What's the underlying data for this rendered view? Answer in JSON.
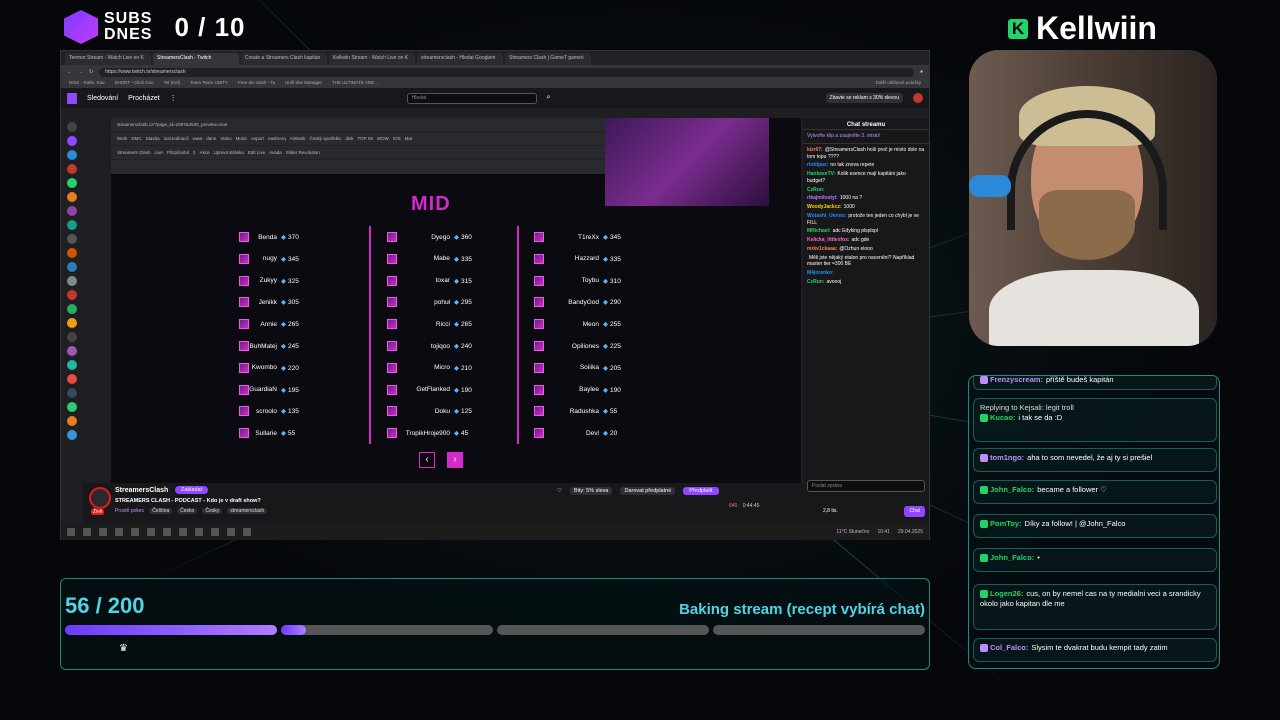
{
  "overlay": {
    "subs_label_1": "SUBS",
    "subs_label_2": "DNES",
    "subs_count": "0 / 10",
    "brand_name": "Kellwiin",
    "goal_count": "56 / 200",
    "goal_title": "Baking stream (recept vybírá chat)",
    "goal_progress": 0.28,
    "colors": {
      "accent_cyan": "#4fd6e6",
      "accent_purple": "#9146ff",
      "accent_magenta": "#d42ac8",
      "brand_green": "#22d36a"
    }
  },
  "browser": {
    "tabs": [
      "Teemor Stream - Watch Live on K",
      "StreamersClash - Twitch",
      "Create a Streamers Clash kapitán",
      "Kellwiin Stream - Watch Live on K",
      "streamersclash - Hledat Googlem",
      "Streamers Clash | GameT gameri"
    ],
    "url": "https://www.twitch.tv/streamersclash",
    "bookmarks": [
      "DISK - Rafie, Kau",
      "SHORT - Click Goo",
      "Tel (Kel)",
      "Team Team UNITY",
      "Free elo clash - Ta",
      "Unifi Site Manager",
      "THE ULTIMATE ARE..."
    ],
    "bookmarks_right": "Další oblíbené položky",
    "twitch_nav": {
      "following": "Sledování",
      "browse": "Procházet",
      "search_placeholder": "Hledat",
      "ad_button": "Zbavte se reklam s 30% slevou"
    },
    "inner_url": "streamersclash.cz/?page_id=2397&3530_preview=true",
    "inner_bookmarks": [
      "Work",
      "DMC",
      "Stavba",
      "Iza/Jedinacil",
      "www",
      "dane",
      "Video",
      "Music",
      "export",
      "nadmorq",
      "AirBank",
      "Český spotřebic",
      "disk",
      "TOP 09",
      "WOW",
      "IOS",
      "Mat"
    ],
    "inner_toolbar": [
      "Streamers Clash",
      "Live",
      "Přizpůsobit",
      "0",
      "Akce",
      "Upravit stránku",
      "Edit Live",
      "Avada",
      "Slider Revolution"
    ],
    "tier_title": "MID",
    "columns": [
      [
        {
          "name": "Benda",
          "points": "370"
        },
        {
          "name": "nugy",
          "points": "345"
        },
        {
          "name": "Zukyy",
          "points": "325"
        },
        {
          "name": "Jenikk",
          "points": "305"
        },
        {
          "name": "Annie",
          "points": "265"
        },
        {
          "name": "BuhMatej",
          "points": "245"
        },
        {
          "name": "Kwombo",
          "points": "220"
        },
        {
          "name": "GuardiaN",
          "points": "195"
        },
        {
          "name": "scroolo",
          "points": "135"
        },
        {
          "name": "Sullarie",
          "points": "55"
        }
      ],
      [
        {
          "name": "Dyego",
          "points": "360"
        },
        {
          "name": "Mabe",
          "points": "335"
        },
        {
          "name": "toxar",
          "points": "315"
        },
        {
          "name": "pohuł",
          "points": "295"
        },
        {
          "name": "Ricci",
          "points": "265"
        },
        {
          "name": "tojiqoo",
          "points": "240"
        },
        {
          "name": "Micro",
          "points": "210"
        },
        {
          "name": "GetFlanked",
          "points": "190"
        },
        {
          "name": "Doku",
          "points": "125"
        },
        {
          "name": "TropikHroje900",
          "points": "45"
        }
      ],
      [
        {
          "name": "T1reXx",
          "points": "345"
        },
        {
          "name": "Hazzard",
          "points": "335"
        },
        {
          "name": "Toybu",
          "points": "310"
        },
        {
          "name": "BandyGod",
          "points": "290"
        },
        {
          "name": "Meon",
          "points": "255"
        },
        {
          "name": "Opiliones",
          "points": "225"
        },
        {
          "name": "Soiiika",
          "points": "205"
        },
        {
          "name": "Baylee",
          "points": "190"
        },
        {
          "name": "Radushka",
          "points": "55"
        },
        {
          "name": "Devl",
          "points": "20"
        }
      ]
    ],
    "channel": {
      "name": "StreamersClash",
      "follow": "Zakladat",
      "title": "STREAMERS CLASH - PODCAST - Kdo je v draft show?",
      "tags_label": "Prostě pokec",
      "tags": [
        "Čeština",
        "Česko",
        "Česky",
        "streamersclash"
      ],
      "live": "Živě",
      "bits": "Bity: 5% sleva",
      "gift": "Darovat předplatné",
      "subscribe": "Předplatit",
      "viewers": "840",
      "uptime": "0:44:45"
    },
    "chat": {
      "header": "Chat streamu",
      "pin": "Vytvořte klip a zaujměte 3. místo!",
      "messages": [
        {
          "user": "kizr07:",
          "text": "@StreamersClash hoši proč je místo dole na tom topu ????",
          "color": "#ff7f50"
        },
        {
          "user": "rlotdpax:",
          "text": "no tak znova repete",
          "color": "#1e90ff"
        },
        {
          "user": "HankeeeTV:",
          "text": "Kolik esence mají kapitáni jako budget?",
          "color": "#22d36a"
        },
        {
          "user": "CzRun:",
          "text": "",
          "color": "#22d36a"
        },
        {
          "user": "rikajmilostyi:",
          "text": "1000 na ?",
          "color": "#b07cff"
        },
        {
          "user": "WoodyJackcz:",
          "text": "1000",
          "color": "#ffd400"
        },
        {
          "user": "Wotashi_Uenno:",
          "text": "protože ten jeden co chybí je ve FILL",
          "color": "#1e90ff"
        },
        {
          "user": "MRichael:",
          "text": "adc Edyking plsplspl",
          "color": "#22d36a"
        },
        {
          "user": "Kelicka_littlexfox:",
          "text": "adc gde",
          "color": "#ff69b4"
        },
        {
          "user": "mrkv1ckaaa:",
          "text": "@Ozhun elooo",
          "color": "#ff7f50"
        },
        {
          "user": "",
          "text": "Měli jste nějaký etalon pro nacenění? Například master tier =300 BE",
          "color": "#ff4040"
        },
        {
          "user": "M4jorenko:",
          "text": "",
          "color": "#1e90ff"
        },
        {
          "user": "CzRun:",
          "text": "avoooj",
          "color": "#22d36a"
        }
      ],
      "input_placeholder": "Poslat zprávu",
      "points": "2,8 tis.",
      "chat_button": "Chat"
    },
    "taskbar": {
      "weather": "11°C Slunečno",
      "time": "10:41",
      "date": "29.04.2025"
    }
  },
  "overlay_chat": [
    {
      "user": "Frenzyscream:",
      "text": "příště budeš kapitán",
      "color": "#c18cff"
    },
    {
      "reply": "Replying to Kejsali: legit troll",
      "user": "Kucao:",
      "text": "i tak se da :D",
      "color": "#22d36a"
    },
    {
      "user": "tom1ngo:",
      "text": "aha to som nevedel, že aj ty si prešiel",
      "color": "#c18cff"
    },
    {
      "user": "John_Falco:",
      "text": "became a follower ♡",
      "color": "#22d36a"
    },
    {
      "user": "PomToy:",
      "text": "Díky za follow! | @John_Falco",
      "color": "#22d36a"
    },
    {
      "user": "John_Falco:",
      "text": "•",
      "color": "#22d36a"
    },
    {
      "user": "Logen26:",
      "text": "cus, on by nemel cas na ty medialni veci a srandicky okolo jako kapitan dle me",
      "color": "#22d36a"
    },
    {
      "user": "Col_Falco:",
      "text": "Slysim te dvakrat budu kempit tady zatim",
      "color": "#c18cff"
    }
  ]
}
